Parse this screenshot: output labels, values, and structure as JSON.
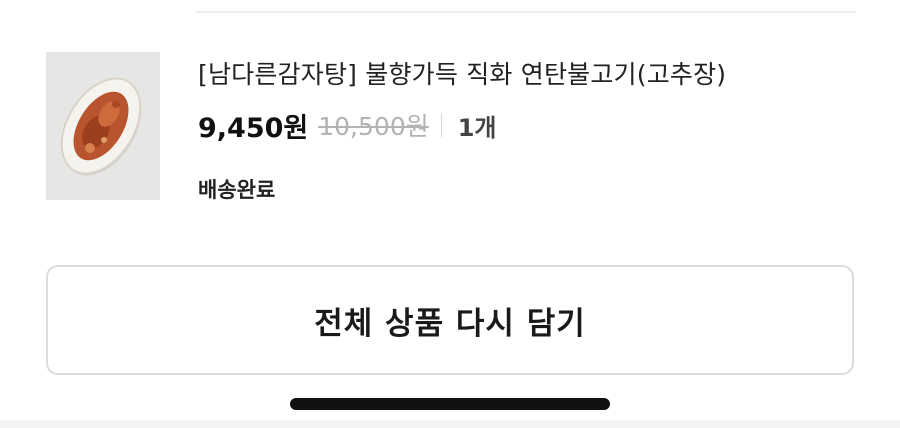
{
  "order_item": {
    "name": "[남다른감자탕] 불향가득 직화 연탄불고기(고추장)",
    "sale_price": "9,450원",
    "original_price": "10,500원",
    "quantity": "1개",
    "status": "배송완료",
    "image_alt": "연탄불고기 상품 이미지"
  },
  "actions": {
    "readd_all_label": "전체 상품 다시 담기"
  },
  "colors": {
    "border": "#dcdcdc",
    "muted_price": "#b3b3b3",
    "text": "#111111"
  }
}
